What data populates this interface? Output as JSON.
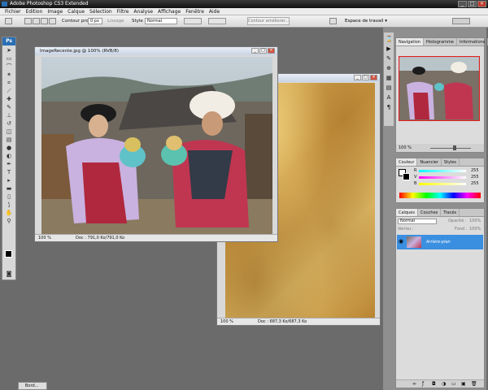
{
  "app": {
    "title": "Adobe Photoshop CS3 Extended"
  },
  "menu": [
    "Fichier",
    "Edition",
    "Image",
    "Calque",
    "Sélection",
    "Filtre",
    "Analyse",
    "Affichage",
    "Fenêtre",
    "Aide"
  ],
  "options": {
    "contour_label": "Contour progr. :",
    "contour_value": "0 px",
    "lissage": "Lissage",
    "style_label": "Style :",
    "style_value": "Normal",
    "contour_btn": "Contour améliorer...",
    "workspace": "Espace de travail ▾"
  },
  "doc1": {
    "title": "ImageRecente.jpg @ 100% (RVB/8)",
    "zoom": "100 %",
    "info": "Doc : 791,0 Ko/791,0 Ko"
  },
  "doc2": {
    "zoom": "100 %",
    "info": "Doc : 687,3 Ko/687,3 Ko"
  },
  "navigator": {
    "tabs": [
      "Navigation",
      "Histogramme",
      "Informations"
    ],
    "zoom": "100 %"
  },
  "color": {
    "tabs": [
      "Couleur",
      "Nuancier",
      "Styles"
    ],
    "r_label": "R",
    "v_label": "V",
    "b_label": "B",
    "r": "255",
    "v": "255",
    "b": "255"
  },
  "layers": {
    "tabs": [
      "Calques",
      "Couches",
      "Tracés"
    ],
    "mode": "Normal",
    "opacity_label": "Opacité :",
    "opacity": "100%",
    "lock_label": "Verrou :",
    "fill_label": "Fond :",
    "fill": "100%",
    "layer_name": "Arrière-plan"
  },
  "taskbar": {
    "label": "Bord..."
  }
}
